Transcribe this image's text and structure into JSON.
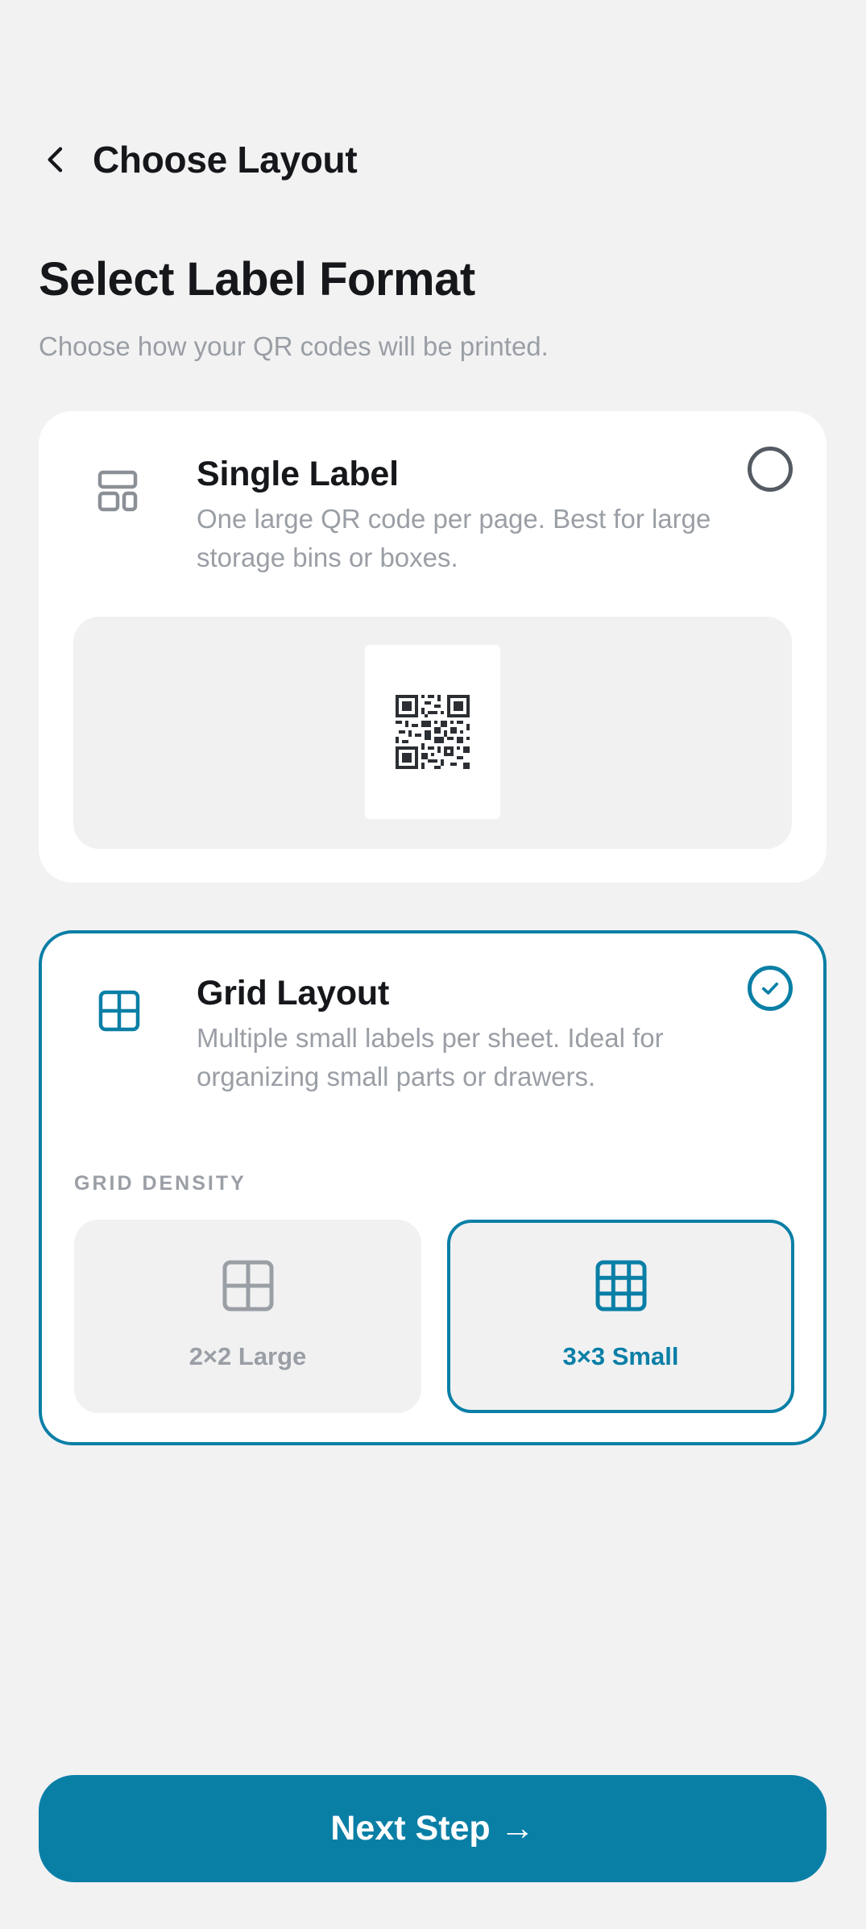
{
  "colors": {
    "accent": "#0a7fa6",
    "background": "#f2f2f3",
    "card": "#ffffff",
    "muted_text": "#9a9ea5",
    "primary_text": "#15171a"
  },
  "header": {
    "back_icon": "chevron-left-icon",
    "title": "Choose Layout"
  },
  "main": {
    "title": "Select Label Format",
    "subtitle": "Choose how your QR codes will be printed."
  },
  "options": {
    "single": {
      "icon": "layout-icon",
      "title": "Single Label",
      "description": "One large QR code per page. Best for large storage bins or boxes.",
      "selected": false,
      "preview_icon": "qr-code-icon"
    },
    "grid": {
      "icon": "grid-2x2-icon",
      "title": "Grid Layout",
      "description": "Multiple small labels per sheet. Ideal for organizing small parts or drawers.",
      "selected": true,
      "density_label": "GRID DENSITY",
      "density_options": [
        {
          "label": "2×2 Large",
          "icon": "grid-2x2-icon",
          "selected": false
        },
        {
          "label": "3×3 Small",
          "icon": "grid-3x3-icon",
          "selected": true
        }
      ]
    }
  },
  "footer": {
    "next_label": "Next Step →"
  }
}
